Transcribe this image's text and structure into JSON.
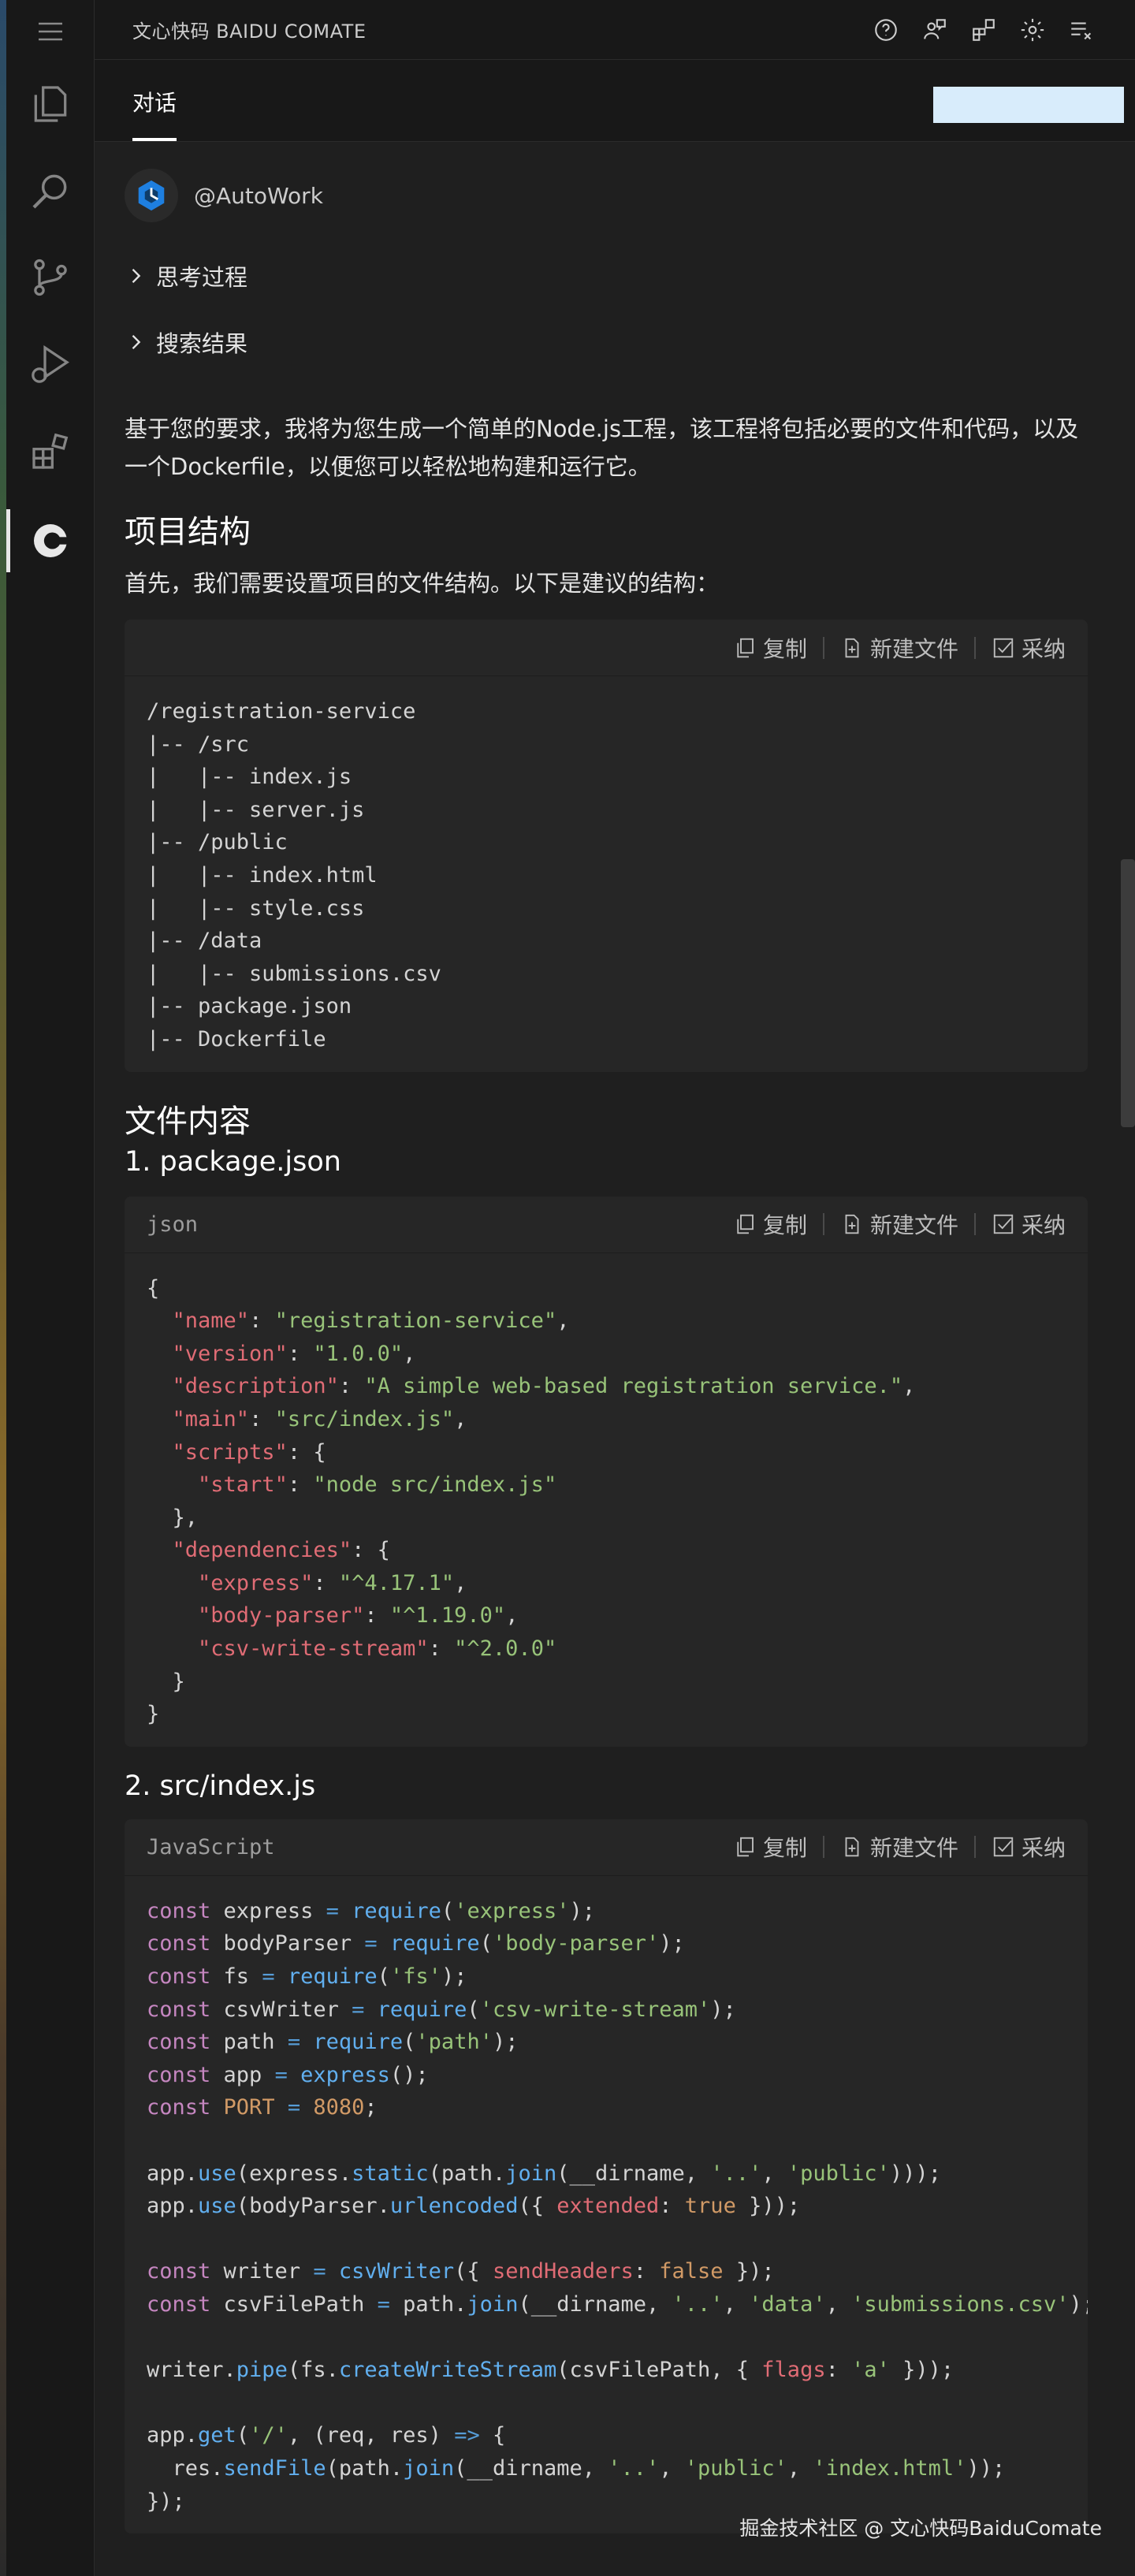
{
  "window": {
    "title": "文心快码 BAIDU COMATE"
  },
  "tabs": [
    {
      "label": "对话"
    }
  ],
  "agent": {
    "name": "@AutoWork"
  },
  "sections": {
    "thinking": "思考过程",
    "search": "搜索结果"
  },
  "intro": "基于您的要求，我将为您生成一个简单的Node.js工程，该工程将包括必要的文件和代码，以及一个Dockerfile，以便您可以轻松地构建和运行它。",
  "project_structure": {
    "heading": "项目结构",
    "desc": "首先，我们需要设置项目的文件结构。以下是建议的结构：",
    "lines": [
      "/registration-service",
      "|-- /src",
      "|   |-- index.js",
      "|   |-- server.js",
      "|-- /public",
      "|   |-- index.html",
      "|   |-- style.css",
      "|-- /data",
      "|   |-- submissions.csv",
      "|-- package.json",
      "|-- Dockerfile"
    ]
  },
  "file_contents": {
    "heading": "文件内容"
  },
  "file1": {
    "heading": "1. package.json",
    "lang": "json"
  },
  "file2": {
    "heading": "2. src/index.js",
    "lang": "JavaScript"
  },
  "code_actions": {
    "copy": "复制",
    "new_file": "新建文件",
    "adopt": "采纳"
  },
  "icons": {
    "menu": "hamburger-menu-icon",
    "explorer": "files-icon",
    "search": "search-icon",
    "scm": "source-control-icon",
    "debug": "run-debug-icon",
    "extensions": "extensions-icon",
    "comate": "comate-icon"
  },
  "watermark": "掘金技术社区 @ 文心快码BaiduComate"
}
